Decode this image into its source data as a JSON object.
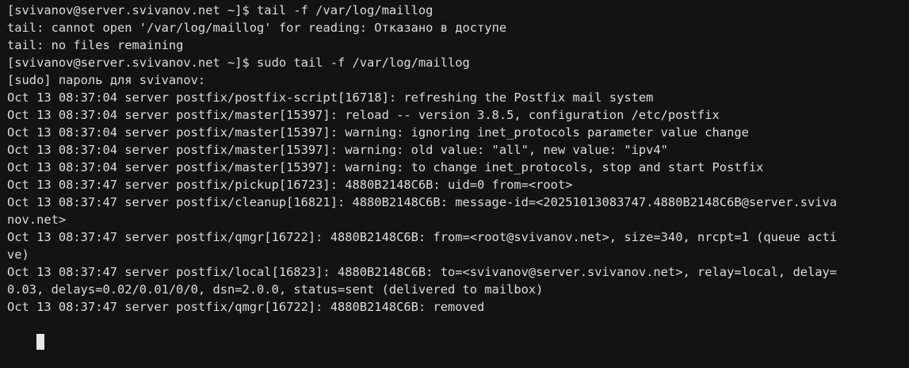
{
  "terminal": {
    "lines": [
      "[svivanov@server.svivanov.net ~]$ tail -f /var/log/maillog",
      "tail: cannot open '/var/log/maillog' for reading: Отказано в доступе",
      "tail: no files remaining",
      "[svivanov@server.svivanov.net ~]$ sudo tail -f /var/log/maillog",
      "[sudo] пароль для svivanov:",
      "Oct 13 08:37:04 server postfix/postfix-script[16718]: refreshing the Postfix mail system",
      "Oct 13 08:37:04 server postfix/master[15397]: reload -- version 3.8.5, configuration /etc/postfix",
      "Oct 13 08:37:04 server postfix/master[15397]: warning: ignoring inet_protocols parameter value change",
      "Oct 13 08:37:04 server postfix/master[15397]: warning: old value: \"all\", new value: \"ipv4\"",
      "Oct 13 08:37:04 server postfix/master[15397]: warning: to change inet_protocols, stop and start Postfix",
      "Oct 13 08:37:47 server postfix/pickup[16723]: 4880B2148C6B: uid=0 from=<root>",
      "Oct 13 08:37:47 server postfix/cleanup[16821]: 4880B2148C6B: message-id=<20251013083747.4880B2148C6B@server.sviva",
      "nov.net>",
      "Oct 13 08:37:47 server postfix/qmgr[16722]: 4880B2148C6B: from=<root@svivanov.net>, size=340, nrcpt=1 (queue acti",
      "ve)",
      "Oct 13 08:37:47 server postfix/local[16823]: 4880B2148C6B: to=<svivanov@server.svivanov.net>, relay=local, delay=",
      "0.03, delays=0.02/0.01/0/0, dsn=2.0.0, status=sent (delivered to mailbox)",
      "Oct 13 08:37:47 server postfix/qmgr[16722]: 4880B2148C6B: removed"
    ]
  }
}
